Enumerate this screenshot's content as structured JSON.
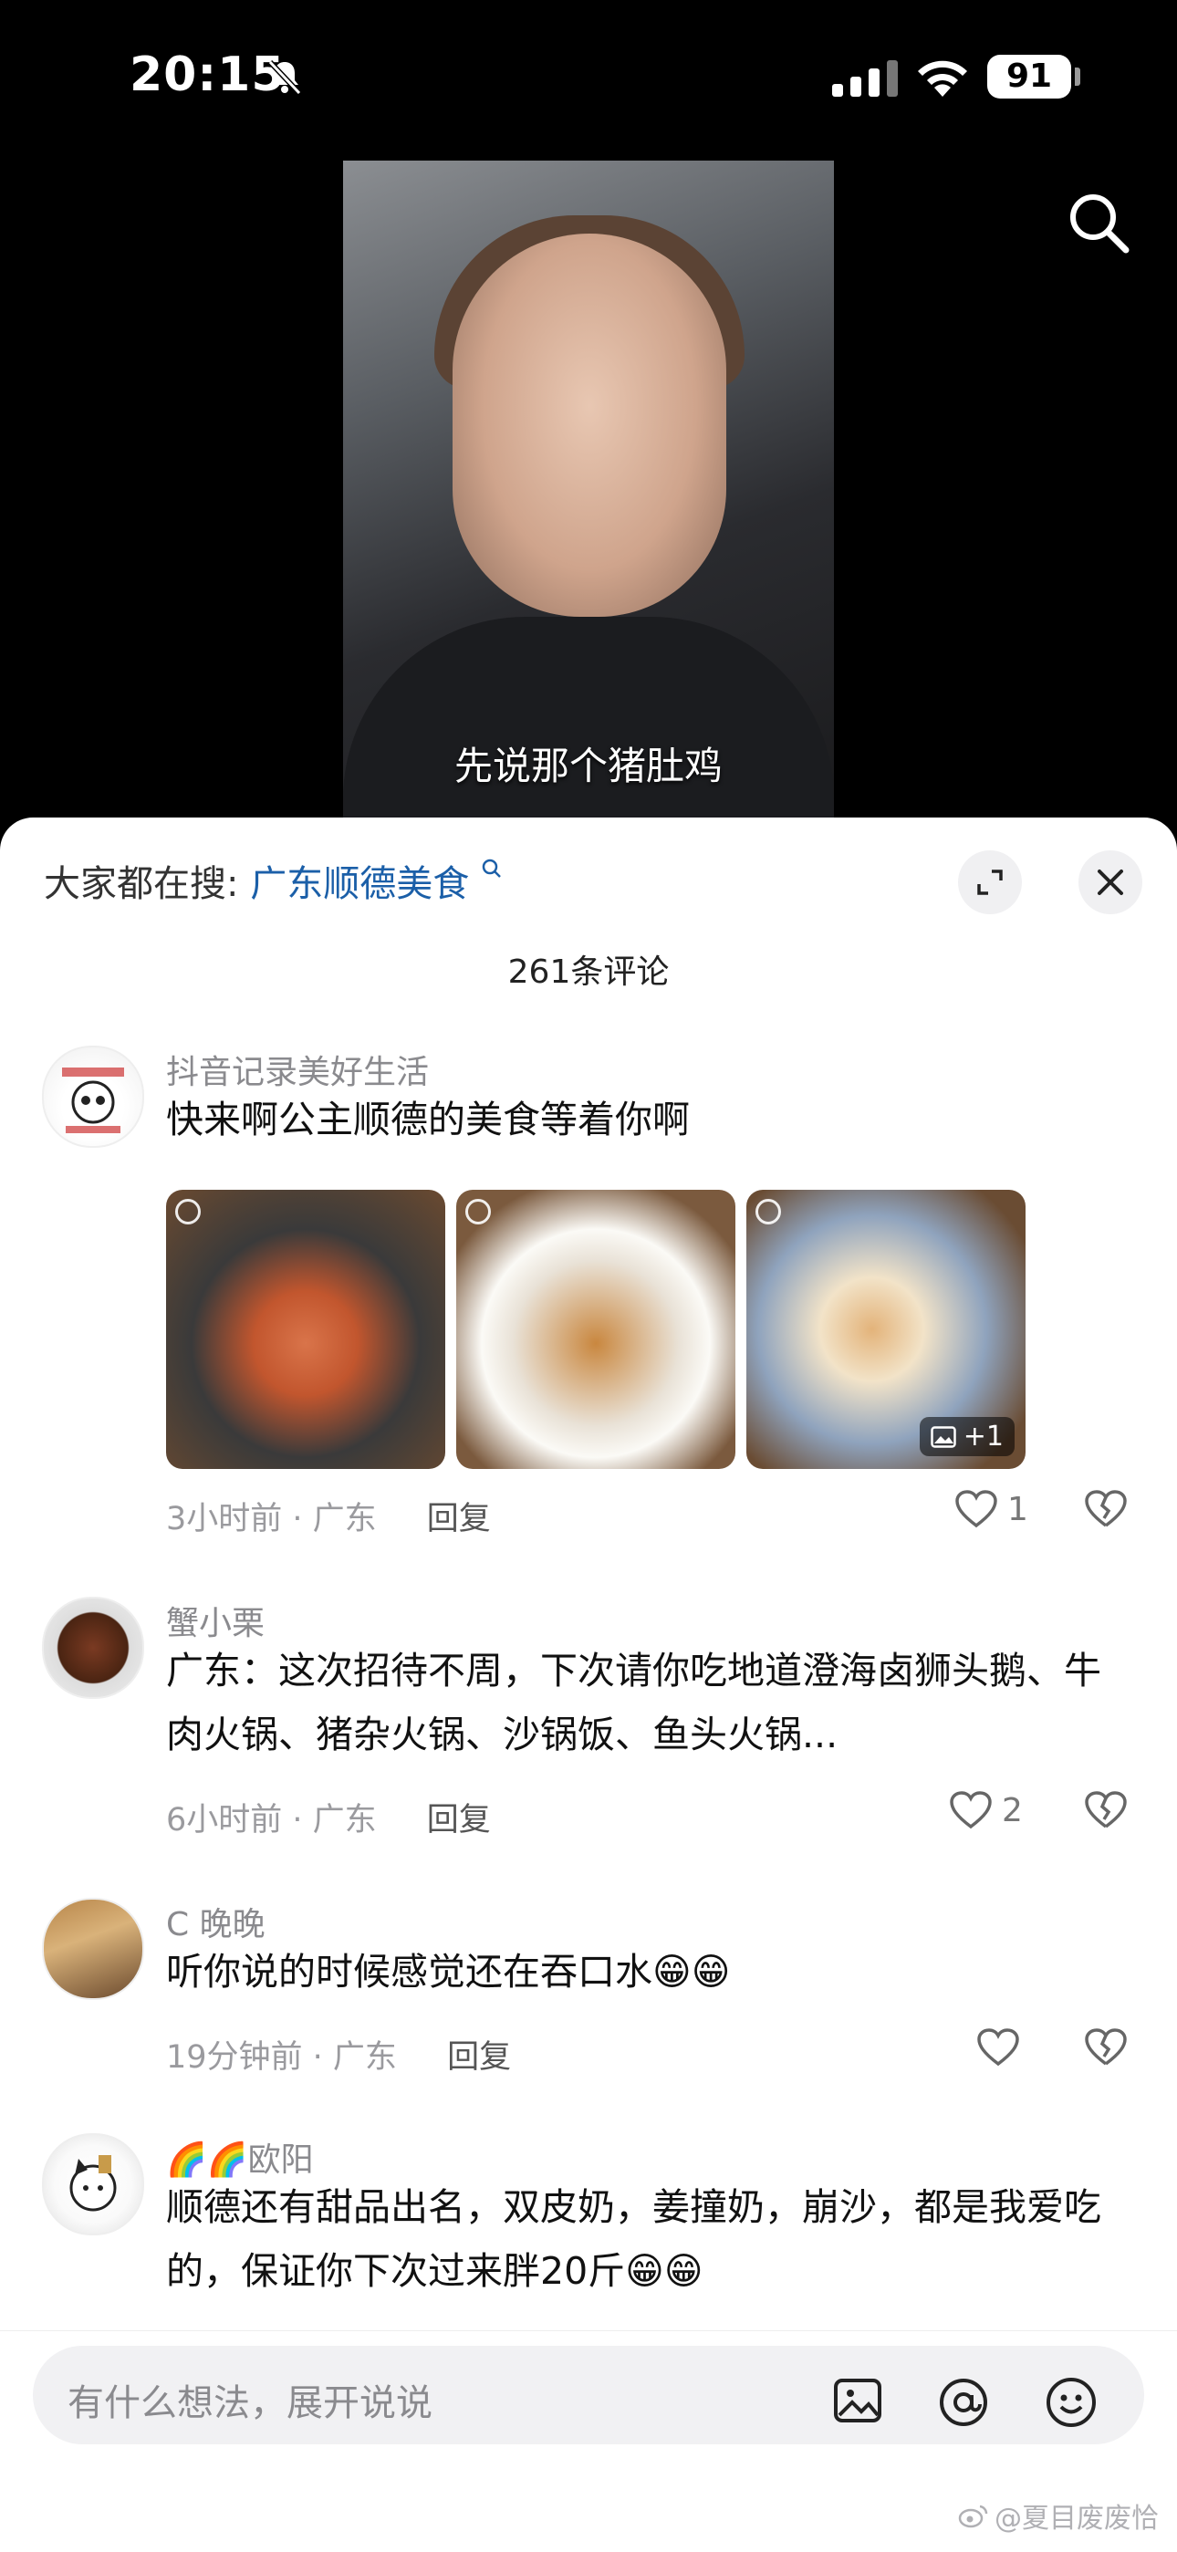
{
  "status_bar": {
    "time": "20:15",
    "battery": "91"
  },
  "video": {
    "subtitle": "先说那个猪肚鸡"
  },
  "sheet": {
    "search_prefix": "大家都在搜:",
    "search_keyword": "广东顺德美食",
    "comment_count": "261条评论"
  },
  "comments": [
    {
      "user": "抖音记录美好生活",
      "text": "快来啊公主顺德的美食等着你啊",
      "time": "3小时前 · 广东",
      "reply": "回复",
      "likes": "1",
      "photos_more": "+1"
    },
    {
      "user": "蟹小栗",
      "text": "广东：这次招待不周，下次请你吃地道澄海卤狮头鹅、牛肉火锅、猪杂火锅、沙锅饭、鱼头火锅...",
      "time": "6小时前 · 广东",
      "reply": "回复",
      "likes": "2"
    },
    {
      "user": "C 晚晚",
      "text": "听你说的时候感觉还在吞口水😁😁",
      "time": "19分钟前 · 广东",
      "reply": "回复",
      "likes": ""
    },
    {
      "user": "🌈🌈欧阳",
      "text": "顺德还有甜品出名，双皮奶，姜撞奶，崩沙，都是我爱吃的，保证你下次过来胖20斤😁😁"
    }
  ],
  "input": {
    "placeholder": "有什么想法，展开说说"
  },
  "watermark": "@夏目废废恰"
}
